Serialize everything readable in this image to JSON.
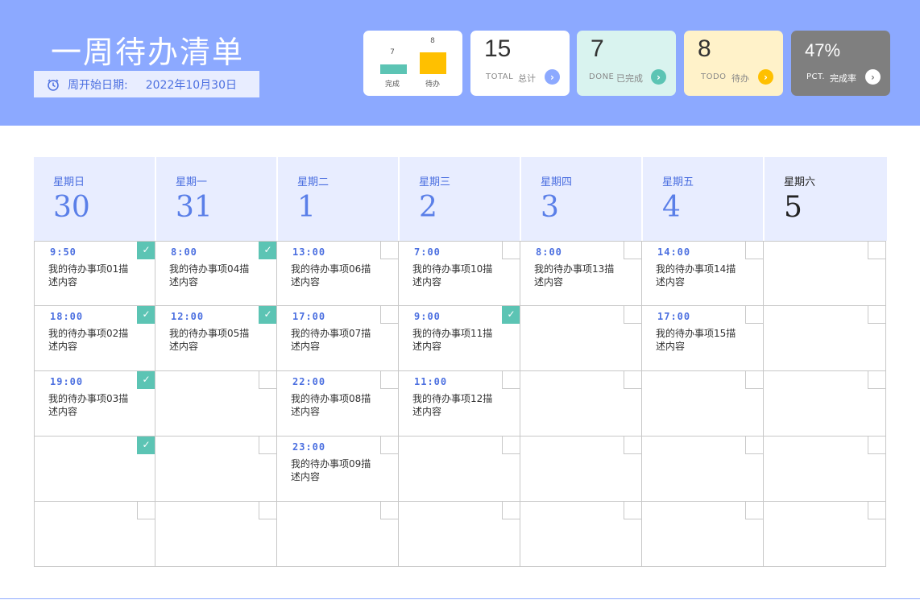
{
  "header": {
    "title": "一周待办清单",
    "start_date_label": "周开始日期:",
    "start_date_value": "2022年10月30日"
  },
  "summary_chart": {
    "done_value": "7",
    "todo_value": "8",
    "done_label": "完成",
    "todo_label": "待办",
    "done_color": "#5cc4b4",
    "todo_color": "#ffc000"
  },
  "stats": {
    "total": {
      "value": "15",
      "en": "TOTAL",
      "cn": "总计",
      "arrow_color": "#8ca9ff"
    },
    "done": {
      "value": "7",
      "en": "DONE",
      "cn": "已完成",
      "arrow_color": "#5cc4b4"
    },
    "todo": {
      "value": "8",
      "en": "TODO",
      "cn": "待办",
      "arrow_color": "#ffc000"
    },
    "pct": {
      "value": "47%",
      "en": "PCT.",
      "cn": "完成率"
    }
  },
  "days": [
    {
      "weekday": "星期日",
      "date": "30"
    },
    {
      "weekday": "星期一",
      "date": "31"
    },
    {
      "weekday": "星期二",
      "date": "1"
    },
    {
      "weekday": "星期三",
      "date": "2"
    },
    {
      "weekday": "星期四",
      "date": "3"
    },
    {
      "weekday": "星期五",
      "date": "4"
    },
    {
      "weekday": "星期六",
      "date": "5"
    }
  ],
  "tasks": [
    [
      {
        "time": "9:50",
        "desc": "我的待办事项01描述内容",
        "done": true
      },
      {
        "time": "18:00",
        "desc": "我的待办事项02描述内容",
        "done": true
      },
      {
        "time": "19:00",
        "desc": "我的待办事项03描述内容",
        "done": true
      },
      {
        "time": "",
        "desc": "",
        "done": true
      },
      {
        "time": "",
        "desc": "",
        "done": false
      }
    ],
    [
      {
        "time": "8:00",
        "desc": "我的待办事项04描述内容",
        "done": true
      },
      {
        "time": "12:00",
        "desc": "我的待办事项05描述内容",
        "done": true
      },
      {
        "time": "",
        "desc": "",
        "done": false
      },
      {
        "time": "",
        "desc": "",
        "done": false
      },
      {
        "time": "",
        "desc": "",
        "done": false
      }
    ],
    [
      {
        "time": "13:00",
        "desc": "我的待办事项06描述内容",
        "done": false
      },
      {
        "time": "17:00",
        "desc": "我的待办事项07描述内容",
        "done": false
      },
      {
        "time": "22:00",
        "desc": "我的待办事项08描述内容",
        "done": false
      },
      {
        "time": "23:00",
        "desc": "我的待办事项09描述内容",
        "done": false
      },
      {
        "time": "",
        "desc": "",
        "done": false
      }
    ],
    [
      {
        "time": "7:00",
        "desc": "我的待办事项10描述内容",
        "done": false
      },
      {
        "time": "9:00",
        "desc": "我的待办事项11描述内容",
        "done": true
      },
      {
        "time": "11:00",
        "desc": "我的待办事项12描述内容",
        "done": false
      },
      {
        "time": "",
        "desc": "",
        "done": false
      },
      {
        "time": "",
        "desc": "",
        "done": false
      }
    ],
    [
      {
        "time": "8:00",
        "desc": "我的待办事项13描述内容",
        "done": false
      },
      {
        "time": "",
        "desc": "",
        "done": false
      },
      {
        "time": "",
        "desc": "",
        "done": false
      },
      {
        "time": "",
        "desc": "",
        "done": false
      },
      {
        "time": "",
        "desc": "",
        "done": false
      }
    ],
    [
      {
        "time": "14:00",
        "desc": "我的待办事项14描述内容",
        "done": false
      },
      {
        "time": "17:00",
        "desc": "我的待办事项15描述内容",
        "done": false
      },
      {
        "time": "",
        "desc": "",
        "done": false
      },
      {
        "time": "",
        "desc": "",
        "done": false
      },
      {
        "time": "",
        "desc": "",
        "done": false
      }
    ],
    [
      {
        "time": "",
        "desc": "",
        "done": false
      },
      {
        "time": "",
        "desc": "",
        "done": false
      },
      {
        "time": "",
        "desc": "",
        "done": false
      },
      {
        "time": "",
        "desc": "",
        "done": false
      },
      {
        "time": "",
        "desc": "",
        "done": false
      }
    ]
  ],
  "icons": {
    "clock": "clock-icon",
    "arrow": "chevron-right-icon",
    "check": "checkmark-icon"
  }
}
